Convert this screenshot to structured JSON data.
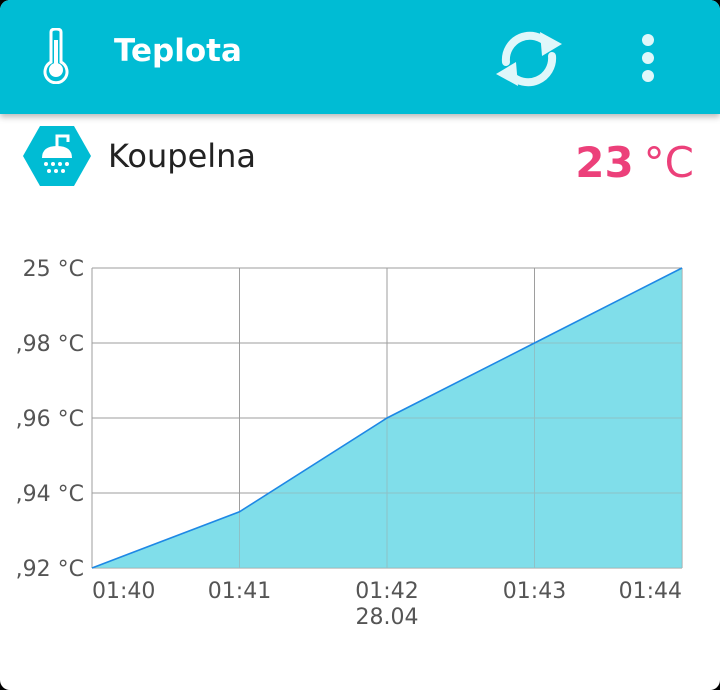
{
  "appbar": {
    "title": "Teplota",
    "color": "#00bcd4",
    "icons": [
      "thermometer-icon",
      "refresh-icon",
      "overflow-menu-icon"
    ]
  },
  "room": {
    "name": "Koupelna",
    "icon": "shower-icon",
    "temperature_value": "23",
    "temperature_unit": "°C",
    "temperature_color": "#ec407a"
  },
  "chart_data": {
    "type": "area",
    "x": [
      "01:40",
      "01:41",
      "01:42",
      "01:43",
      "01:44"
    ],
    "x_sublabels": [
      "",
      "",
      "28.04",
      "",
      ""
    ],
    "y_tick_labels": [
      ",92 °C",
      ",94 °C",
      ",96 °C",
      ",98 °C",
      "25 °C"
    ],
    "values": [
      0,
      0.75,
      2,
      3,
      4
    ],
    "ylim": [
      0,
      4
    ],
    "grid": true,
    "fill_color": "#80deea",
    "line_color": "#1e88e5"
  }
}
